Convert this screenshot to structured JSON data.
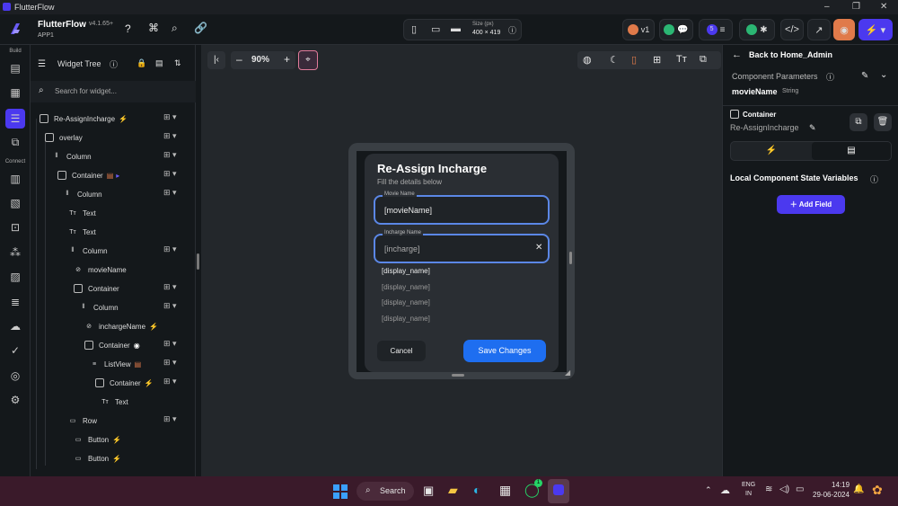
{
  "window": {
    "title": "FlutterFlow"
  },
  "header": {
    "app_name": "FlutterFlow",
    "version": "v4.1.65+",
    "project": "APP1",
    "size_label": "Size (px)",
    "size_value": "400 × 419",
    "branch": "v1",
    "notifications": "5"
  },
  "left_rail": {
    "build_label": "Build",
    "connect_label": "Connect"
  },
  "tree": {
    "title": "Widget Tree",
    "search_placeholder": "Search for widget...",
    "rows": [
      {
        "label": "Re-AssignIncharge"
      },
      {
        "label": "overlay"
      },
      {
        "label": "Column"
      },
      {
        "label": "Container"
      },
      {
        "label": "Column"
      },
      {
        "label": "Text"
      },
      {
        "label": "Text"
      },
      {
        "label": "Column"
      },
      {
        "label": "movieName"
      },
      {
        "label": "Container"
      },
      {
        "label": "Column"
      },
      {
        "label": "inchargeName"
      },
      {
        "label": "Container"
      },
      {
        "label": "ListView"
      },
      {
        "label": "Container"
      },
      {
        "label": "Text"
      },
      {
        "label": "Row"
      },
      {
        "label": "Button"
      },
      {
        "label": "Button"
      }
    ]
  },
  "canvas": {
    "zoom": "90%"
  },
  "dialog": {
    "title": "Re-Assign Incharge",
    "subtitle": "Fill the details below",
    "movie_label": "Movie Name",
    "movie_value": "[movieName]",
    "incharge_label": "Incharge Name",
    "incharge_value": "[incharge]",
    "options": [
      "[display_name]",
      "[display_name]",
      "[display_name]",
      "[display_name]"
    ],
    "cancel": "Cancel",
    "save": "Save Changes"
  },
  "right_panel": {
    "back": "Back to Home_Admin",
    "params_title": "Component Parameters",
    "param_name": "movieName",
    "param_type": "String",
    "widget_type": "Container",
    "widget_name": "Re-AssignIncharge",
    "state_title": "Local Component State Variables",
    "add_field": "Add Field"
  },
  "taskbar": {
    "search": "Search",
    "lang1": "ENG",
    "lang2": "IN",
    "time": "14:19",
    "date": "29-06-2024",
    "whatsapp_badge": "1"
  },
  "colors": {
    "accent": "#4b39ef",
    "save_button": "#1e6ef0",
    "field_border": "#5b87e6",
    "taskbar": "#3a1a2a"
  }
}
